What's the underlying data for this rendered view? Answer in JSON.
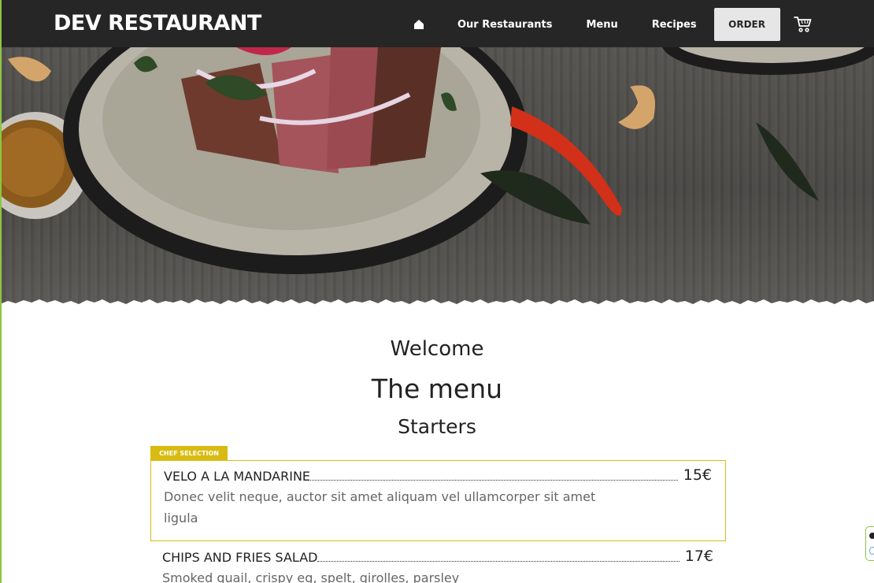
{
  "header": {
    "logo": "DEV RESTAURANT",
    "nav": {
      "home_icon": "home-icon",
      "links": [
        "Our Restaurants",
        "Menu",
        "Recipes"
      ],
      "order_label": "ORDER",
      "cart_icon": "cart-icon"
    }
  },
  "hero": {
    "image": "food-photo"
  },
  "content": {
    "welcome": "Welcome",
    "title": "The menu",
    "section": "Starters",
    "chef_badge": "CHEF SELECTION",
    "items": [
      {
        "name": "VELO A LA MANDARINE",
        "price": "15€",
        "description": "Donec velit neque, auctor sit amet aliquam vel ullamcorper sit amet ligula"
      },
      {
        "name": "CHIPS AND FRIES SALAD",
        "price": "17€",
        "description": "Smoked quail, crispy eg, spelt, girolles, parsley"
      }
    ]
  },
  "colors": {
    "header_bg": "#262626",
    "accent_gold": "#d8bb12",
    "accent_green": "#8cc63f"
  }
}
